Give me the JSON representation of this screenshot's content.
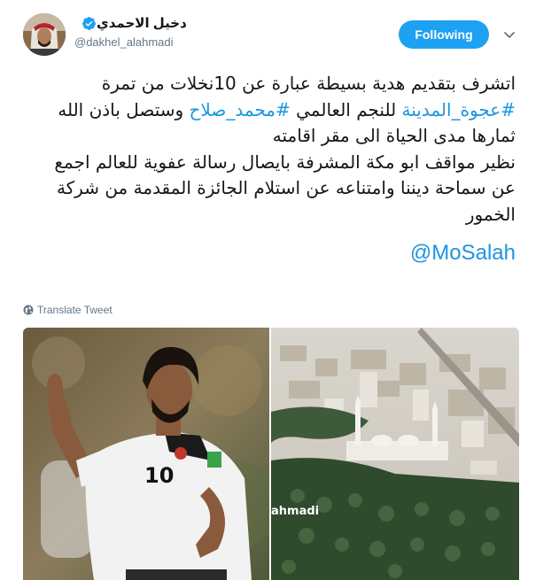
{
  "user": {
    "display_name": "دخيل الاحمدي",
    "handle": "@dakhel_alahmadi",
    "verified": true
  },
  "follow_button": {
    "label": "Following"
  },
  "tweet": {
    "line1": "اتشرف بتقديم هدية بسيطة عبارة عن 10نخلات من تمرة",
    "line2_tag1": "#عجوة_المدينة",
    "line2_mid": " للنجم العالمي ",
    "line2_tag2": "#محمد_صلاح",
    "line2_end": " وستصل باذن الله",
    "line3": "ثمارها مدى الحياة الى مقر اقامته",
    "line4": "نظير مواقف ابو مكة المشرفة بايصال رسالة عفوية للعالم اجمع",
    "line5": "عن سماحة ديننا وامتناعه عن استلام الجائزة المقدمة من شركة",
    "line6": "الخمور",
    "mention": "@MoSalah"
  },
  "translate": {
    "label": "Translate Tweet"
  },
  "media": {
    "left_photo": "football-player-photo",
    "right_photo": "aerial-city-mosque-palms-photo",
    "watermark": "ahmadi"
  },
  "colors": {
    "accent": "#1da1f2",
    "link": "#1b95e0",
    "text": "#14171a",
    "muted": "#657786"
  }
}
